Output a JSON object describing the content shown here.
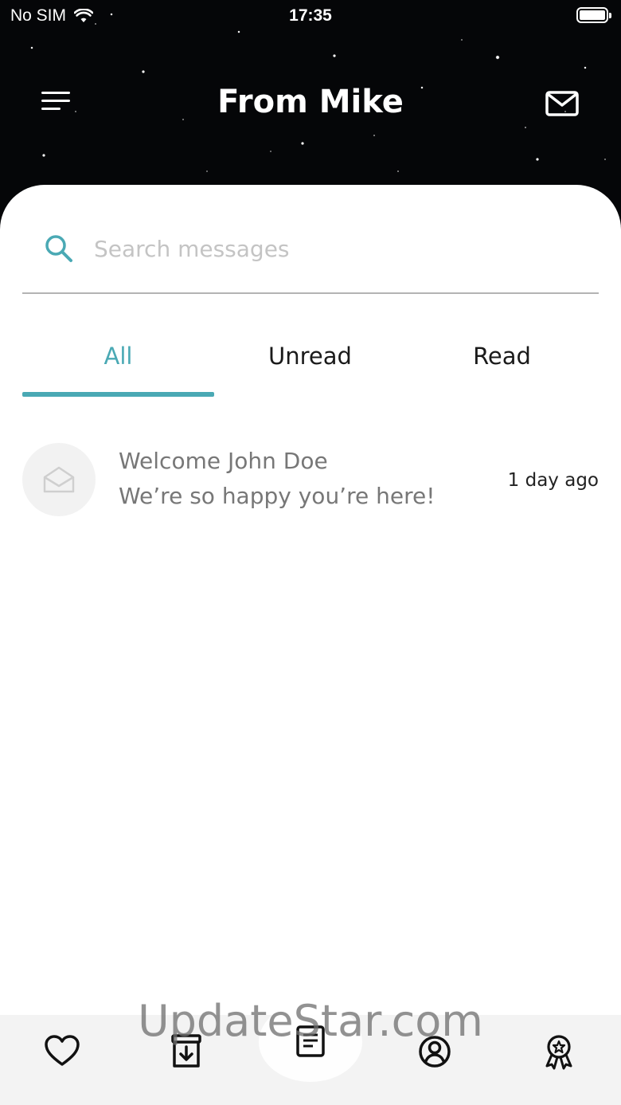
{
  "status_bar": {
    "carrier": "No SIM",
    "time": "17:35"
  },
  "header": {
    "title": "From Mike"
  },
  "search": {
    "placeholder": "Search messages",
    "value": ""
  },
  "tabs": [
    {
      "label": "All",
      "active": true
    },
    {
      "label": "Unread",
      "active": false
    },
    {
      "label": "Read",
      "active": false
    }
  ],
  "messages": [
    {
      "title": "Welcome John Doe",
      "body": "We’re so happy you’re here!",
      "time": "1 day ago",
      "icon": "open-envelope-icon"
    }
  ],
  "bottom_nav": {
    "items": [
      {
        "icon": "heart-icon"
      },
      {
        "icon": "archive-download-icon"
      },
      {
        "icon": "document-icon",
        "active": true
      },
      {
        "icon": "user-circle-icon"
      },
      {
        "icon": "award-ribbon-icon"
      }
    ]
  },
  "watermark": "UpdateStar.com",
  "colors": {
    "accent": "#4aa9b4",
    "header_bg": "#050608",
    "nav_bg": "#f3f3f3"
  }
}
